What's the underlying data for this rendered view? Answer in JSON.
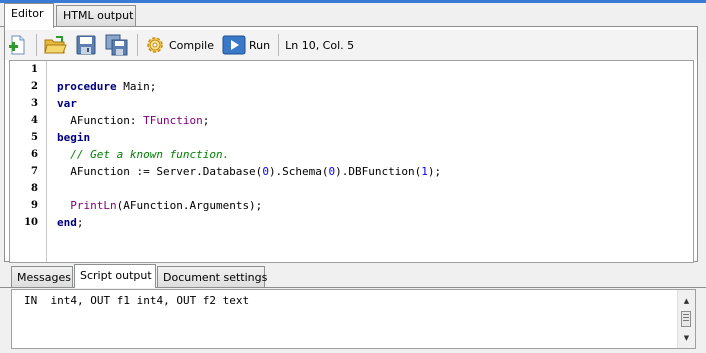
{
  "top_tabs": [
    {
      "label": "Editor",
      "active": true
    },
    {
      "label": "HTML output",
      "active": false
    }
  ],
  "toolbar": {
    "new_icon": "new-document-icon",
    "open_icon": "open-folder-icon",
    "save_icon": "save-icon",
    "save_all_icon": "save-all-icon",
    "compile_label": "Compile",
    "compile_icon": "gear-icon",
    "run_label": "Run",
    "run_icon": "play-icon",
    "cursor_position": "Ln 10, Col. 5"
  },
  "editor": {
    "line_numbers": [
      "1",
      "2",
      "3",
      "4",
      "5",
      "6",
      "7",
      "8",
      "9",
      "10"
    ],
    "lines": [
      "",
      "procedure Main;",
      "var",
      "  AFunction: TFunction;",
      "begin",
      "  // Get a known function.",
      "  AFunction := Server.Database(0).Schema(0).DBFunction(1);",
      "",
      "  PrintLn(AFunction.Arguments);",
      "end;"
    ]
  },
  "bottom_tabs": [
    {
      "label": "Messages",
      "active": false
    },
    {
      "label": "Script output",
      "active": true
    },
    {
      "label": "Document settings",
      "active": false
    }
  ],
  "output": {
    "text": "IN  int4, OUT f1 int4, OUT f2 text"
  },
  "colors": {
    "keyword": "#000080",
    "type": "#800080",
    "comment": "#008000",
    "number": "#0000ff",
    "accent": "#3a7bd5"
  }
}
